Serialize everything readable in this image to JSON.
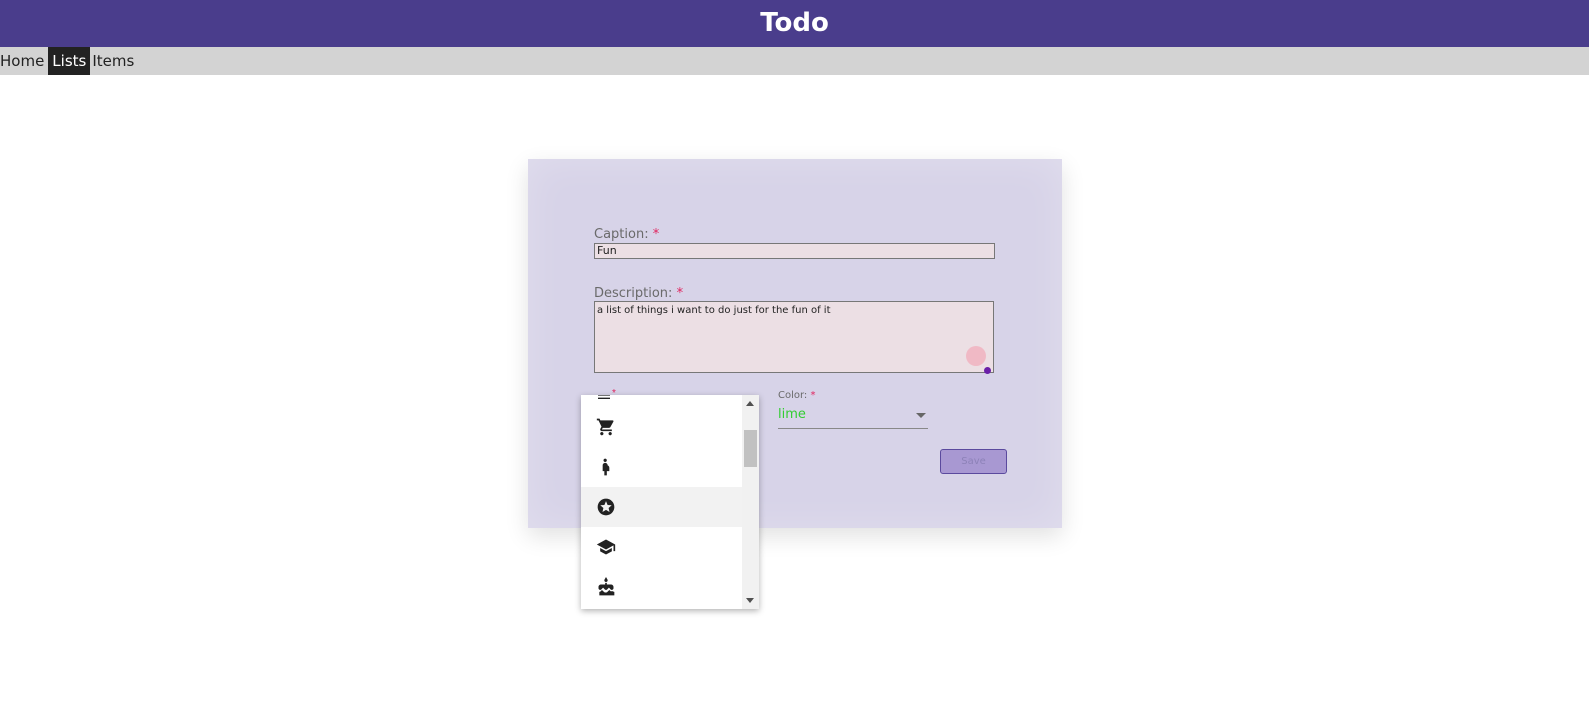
{
  "header": {
    "title": "Todo"
  },
  "nav": {
    "items": [
      {
        "label": "Home",
        "active": false
      },
      {
        "label": "Lists",
        "active": true
      },
      {
        "label": "Items",
        "active": false
      }
    ]
  },
  "form": {
    "caption": {
      "label": "Caption:",
      "required": "*",
      "value": "Fun"
    },
    "description": {
      "label": "Description:",
      "required": "*",
      "value": "a list of things i want to do just for the fun of it"
    },
    "icon": {
      "required": "*"
    },
    "color": {
      "label": "Color:",
      "required": "*",
      "value": "lime",
      "value_color": "#32cd32"
    },
    "save_label": "Save"
  },
  "icon_dropdown": {
    "options": [
      {
        "icon": "menu-icon"
      },
      {
        "icon": "shopping-cart-icon"
      },
      {
        "icon": "pregnant-woman-icon"
      },
      {
        "icon": "stars-icon",
        "highlighted": true
      },
      {
        "icon": "school-icon"
      },
      {
        "icon": "cake-icon"
      }
    ]
  },
  "colors": {
    "header_bg": "#4a3d8c",
    "card_bg": "#d7d3e8",
    "save_bg": "#a898d2"
  }
}
